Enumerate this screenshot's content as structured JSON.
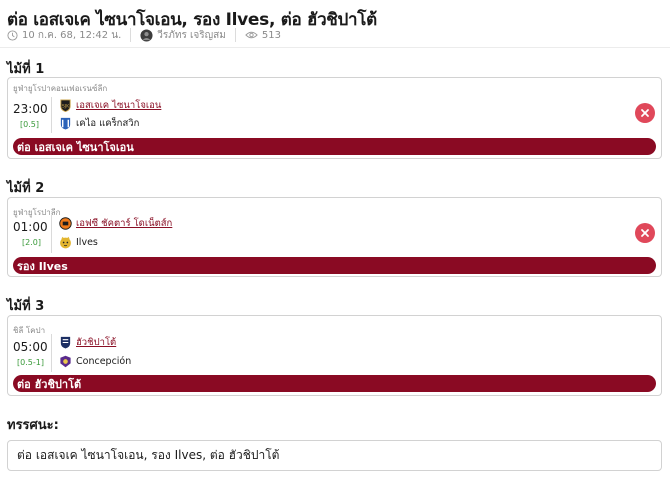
{
  "article": {
    "title": "ต่อ เอสเจเค ไซนาโจเอน, รอง Ilves, ต่อ ฮัวชิปาโต้",
    "date": "10 ก.ค. 68, 12:42 น.",
    "author": "วีรภัทร เจริญสม",
    "views": "513"
  },
  "matches": [
    {
      "label": "ไม้ที่ 1",
      "league": "ยูฟ่ายูโรปาคอนเฟอเรนซ์ลีก",
      "time": "23:00",
      "handicap": "[0.5]",
      "home": {
        "name": "เอสเจเค ไซนาโจเอน",
        "favored": true,
        "icon": "sjk-crest-icon"
      },
      "away": {
        "name": "เคไอ แคร็กสวิก",
        "favored": false,
        "icon": "ki-klaksvik-crest-icon"
      },
      "tip": "ต่อ เอสเจเค ไซนาโจเอน",
      "removable": true
    },
    {
      "label": "ไม้ที่ 2",
      "league": "ยูฟ่ายูโรปาลีก",
      "time": "01:00",
      "handicap": "[2.0]",
      "home": {
        "name": "เอฟซี ชัคตาร์ โดเน็ตส์ก",
        "favored": true,
        "icon": "shakhtar-crest-icon"
      },
      "away": {
        "name": "Ilves",
        "favored": false,
        "icon": "ilves-crest-icon"
      },
      "tip": "รอง Ilves",
      "removable": true
    },
    {
      "label": "ไม้ที่ 3",
      "league": "ชิลี โคปา",
      "time": "05:00",
      "handicap": "[0.5-1]",
      "home": {
        "name": "ฮัวชิปาโต้",
        "favored": true,
        "icon": "huachipato-crest-icon"
      },
      "away": {
        "name": "Concepción",
        "favored": false,
        "icon": "concepcion-crest-icon"
      },
      "tip": "ต่อ ฮัวชิปาโต้",
      "removable": false
    }
  ],
  "summary": {
    "label": "ทรรศนะ:",
    "text": "ต่อ เอสเจเค ไซนาโจเอน, รอง Ilves, ต่อ ฮัวชิปาโต้"
  },
  "colors": {
    "accent": "#8a0a23",
    "handicap": "#3a9a3a",
    "remove": "#e0485a"
  }
}
